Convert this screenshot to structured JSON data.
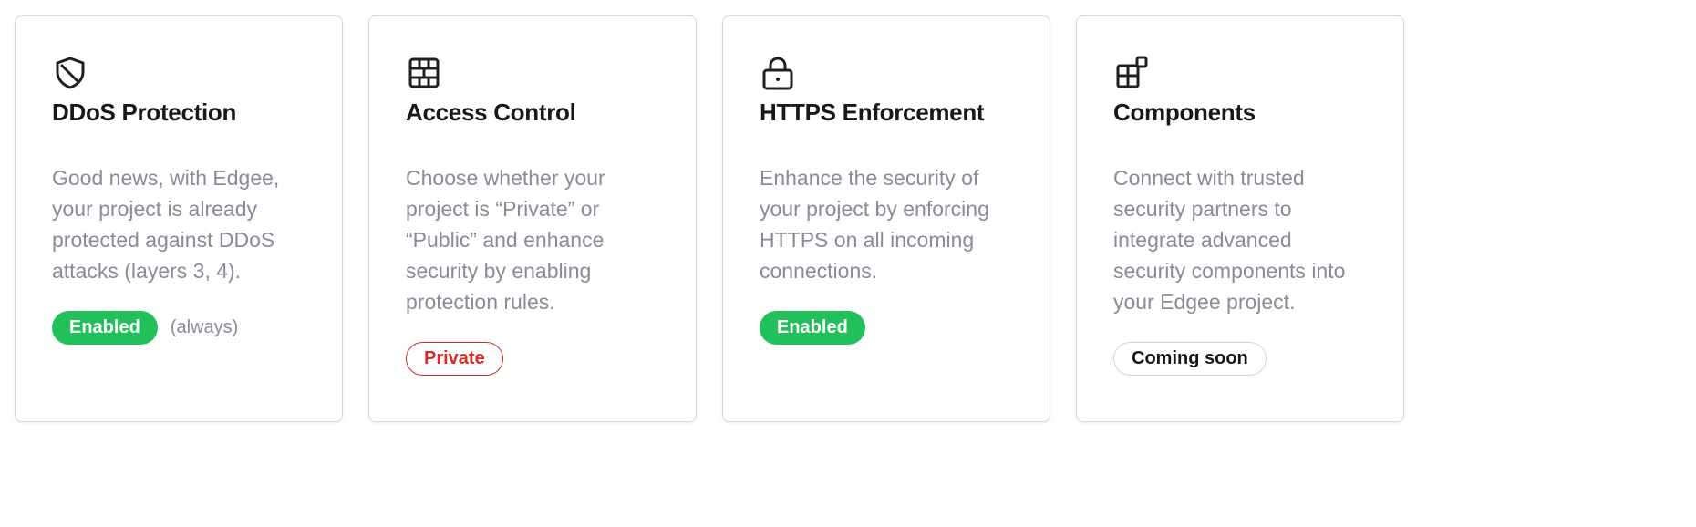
{
  "cards": [
    {
      "icon": "shield-icon",
      "title": "DDoS Protection",
      "description": "Good news, with Edgee, your project is already protected against DDoS attacks (layers 3, 4).",
      "badge": "Enabled",
      "note": "(always)"
    },
    {
      "icon": "firewall-icon",
      "title": "Access Control",
      "description": "Choose whether your project is “Private” or “Public” and enhance security by enabling protection rules.",
      "badge": "Private"
    },
    {
      "icon": "lock-icon",
      "title": "HTTPS Enforcement",
      "description": "Enhance the security of your project by enforcing HTTPS on all incoming connections.",
      "badge": "Enabled"
    },
    {
      "icon": "components-icon",
      "title": "Components",
      "description": "Connect with trusted security partners to integrate advanced security components into your Edgee project.",
      "badge": "Coming soon"
    }
  ],
  "colors": {
    "enabled": "#22c05a",
    "private": "#d82a2a",
    "muted_text": "#8b8b98",
    "title_text": "#17171c"
  }
}
